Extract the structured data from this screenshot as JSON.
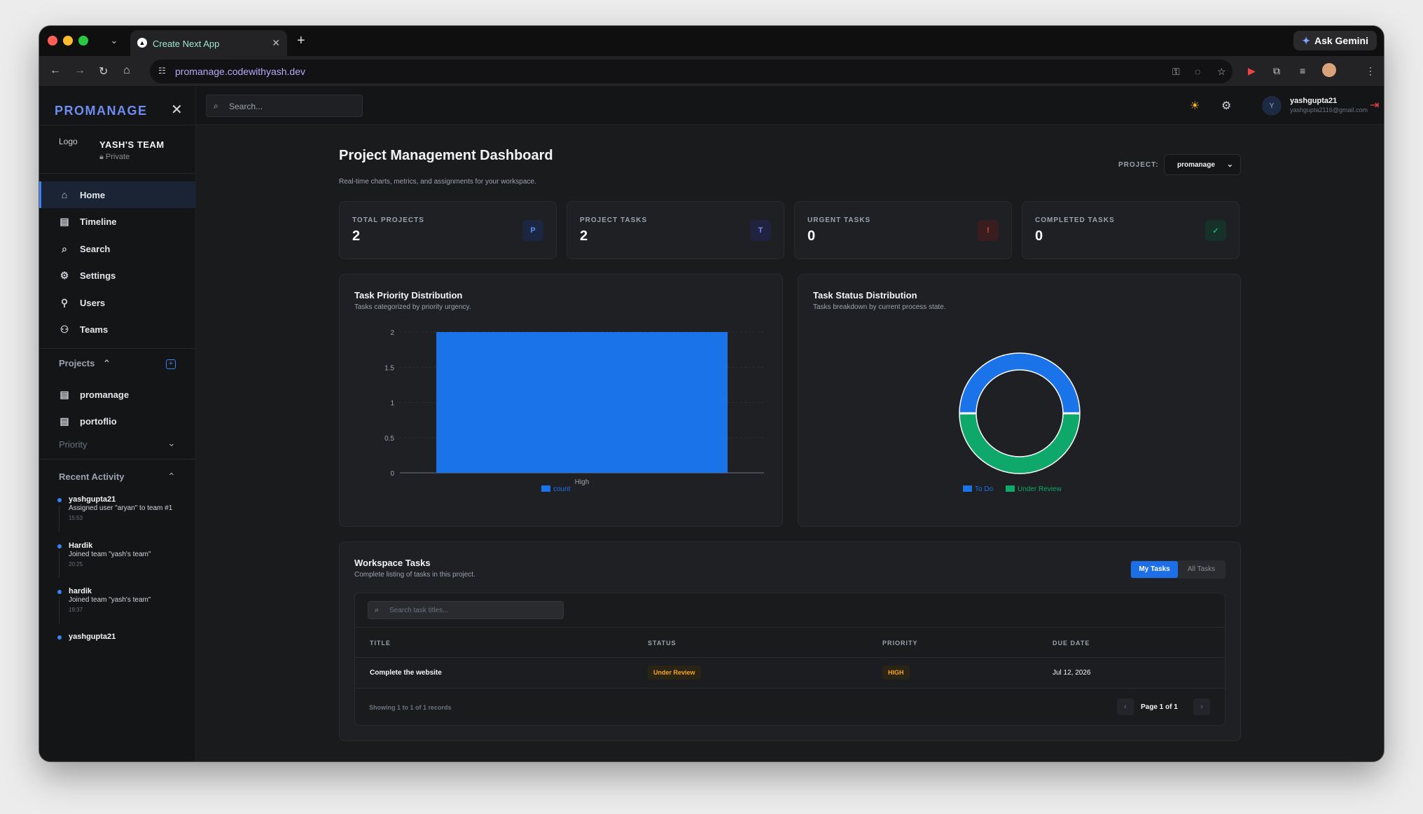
{
  "browser": {
    "tab_title": "Create Next App",
    "url": "promanage.codewithyash.dev",
    "gemini_label": "Ask Gemini"
  },
  "sidebar": {
    "brand": "PROMANAGE",
    "team_logo_alt": "Logo",
    "team_name": "YASH'S TEAM",
    "team_visibility": "Private",
    "nav": [
      {
        "label": "Home",
        "icon": "home-icon"
      },
      {
        "label": "Timeline",
        "icon": "briefcase-icon"
      },
      {
        "label": "Search",
        "icon": "search-icon"
      },
      {
        "label": "Settings",
        "icon": "gear-icon"
      },
      {
        "label": "Users",
        "icon": "user-icon"
      },
      {
        "label": "Teams",
        "icon": "users-icon"
      }
    ],
    "projects_header": "Projects",
    "projects": [
      {
        "label": "promanage"
      },
      {
        "label": "portoflio"
      }
    ],
    "priority_header": "Priority",
    "activity_header": "Recent Activity",
    "activity": [
      {
        "user": "yashgupta21",
        "message": "Assigned user \"aryan\" to team #1",
        "time": "15:53"
      },
      {
        "user": "Hardik",
        "message": "Joined team \"yash's team\"",
        "time": "20:25"
      },
      {
        "user": "hardik",
        "message": "Joined team \"yash's team\"",
        "time": "19:37"
      },
      {
        "user": "yashgupta21",
        "message": "",
        "time": ""
      }
    ]
  },
  "topbar": {
    "search_placeholder": "Search...",
    "avatar_initial": "Y",
    "username": "yashgupta21",
    "email": "yashgupta2116@gmail.com"
  },
  "main": {
    "title": "Project Management Dashboard",
    "subtitle": "Real-time charts, metrics, and assignments for your workspace.",
    "project_label": "PROJECT:",
    "project_selected": "promanage",
    "stats": [
      {
        "label": "TOTAL PROJECTS",
        "value": "2",
        "badge": "P",
        "badge_bg": "#1c2640",
        "badge_fg": "#5b8cf0"
      },
      {
        "label": "PROJECT TASKS",
        "value": "2",
        "badge": "T",
        "badge_bg": "#1f2340",
        "badge_fg": "#7c83f0"
      },
      {
        "label": "URGENT TASKS",
        "value": "0",
        "badge": "!",
        "badge_bg": "#3a1d1f",
        "badge_fg": "#ef4444"
      },
      {
        "label": "COMPLETED TASKS",
        "value": "0",
        "badge": "✓",
        "badge_bg": "#173028",
        "badge_fg": "#10b981"
      }
    ],
    "priority_chart": {
      "title": "Task Priority Distribution",
      "subtitle": "Tasks categorized by priority urgency."
    },
    "status_chart": {
      "title": "Task Status Distribution",
      "subtitle": "Tasks breakdown by current process state."
    },
    "tasks": {
      "title": "Workspace Tasks",
      "subtitle": "Complete listing of tasks in this project.",
      "tab_mine": "My Tasks",
      "tab_all": "All Tasks",
      "search_placeholder": "Search task titles...",
      "columns": [
        "TITLE",
        "STATUS",
        "PRIORITY",
        "DUE DATE"
      ],
      "rows": [
        {
          "title": "Complete the website",
          "status": "Under Review",
          "priority": "HIGH",
          "due": "Jul 12, 2026"
        }
      ],
      "showing": "Showing 1 to 1 of 1 records",
      "page": "Page 1 of 1"
    }
  },
  "chart_data": [
    {
      "type": "bar",
      "categories": [
        "High"
      ],
      "series": [
        {
          "name": "count",
          "values": [
            2
          ],
          "color": "#1a73e8"
        }
      ],
      "ylim": [
        0,
        2
      ],
      "yticks": [
        0,
        0.5,
        1,
        1.5,
        2
      ],
      "grid": true,
      "legend": "bottom"
    },
    {
      "type": "pie",
      "donut": true,
      "labels": [
        "To Do",
        "Under Review"
      ],
      "values": [
        1,
        1
      ],
      "colors": [
        "#1a73e8",
        "#0fa86b"
      ],
      "legend": "bottom"
    }
  ]
}
